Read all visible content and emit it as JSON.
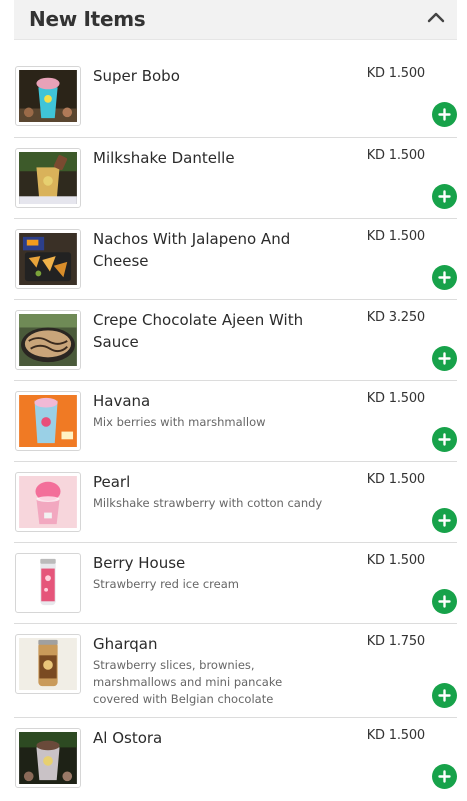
{
  "section": {
    "title": "New Items",
    "collapse_icon": "chevron-up-icon"
  },
  "colors": {
    "add_button": "#17a24a",
    "header_bg": "#f2f2f2",
    "divider": "#dcdcdc"
  },
  "items": [
    {
      "name": "Super Bobo",
      "description": "",
      "price": "KD 1.500"
    },
    {
      "name": "Milkshake Dantelle",
      "description": "",
      "price": "KD 1.500"
    },
    {
      "name": "Nachos With Jalapeno And Cheese",
      "description": "",
      "price": "KD 1.500"
    },
    {
      "name": "Crepe Chocolate Ajeen With Sauce",
      "description": "",
      "price": "KD 3.250"
    },
    {
      "name": "Havana",
      "description": "Mix berries with marshmallow",
      "price": "KD 1.500"
    },
    {
      "name": "Pearl",
      "description": "Milkshake strawberry with cotton candy",
      "price": "KD 1.500"
    },
    {
      "name": "Berry House",
      "description": "Strawberry red ice cream",
      "price": "KD 1.500"
    },
    {
      "name": "Gharqan",
      "description": "Strawberry slices, brownies, marshmallows and mini pancake covered with Belgian chocolate",
      "price": "KD 1.750"
    },
    {
      "name": "Al Ostora",
      "description": "",
      "price": "KD 1.500"
    }
  ]
}
